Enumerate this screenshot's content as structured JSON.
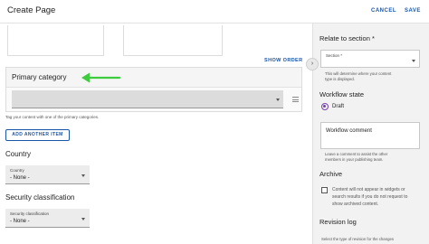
{
  "header": {
    "title": "Create Page",
    "cancel_label": "CANCEL",
    "save_label": "SAVE"
  },
  "main": {
    "show_order_label": "SHOW ORDER",
    "primary_category": {
      "title": "Primary category",
      "selected_value": "",
      "help_text": "Tag your content with one of the primary categories."
    },
    "add_item_label": "ADD ANOTHER ITEM",
    "country": {
      "section_title": "Country",
      "field_label": "Country",
      "value": "- None -"
    },
    "security": {
      "section_title": "Security classification",
      "field_label": "Security classification",
      "value": "- None -"
    }
  },
  "sidebar": {
    "toggle_icon": "chevron-right-icon",
    "relate": {
      "title": "Relate to section *",
      "field_label": "Section *",
      "help_text_1": "This will determine where your content",
      "help_text_2": "type is displayed."
    },
    "workflow": {
      "title": "Workflow state",
      "option_label": "Draft",
      "accent_color": "#7a3fb5"
    },
    "workflow_comment": {
      "field_label": "Workflow comment",
      "help_text_1": "Leave a comment to assist the other",
      "help_text_2": "members in your publishing team."
    },
    "archive": {
      "title": "Archive",
      "checkbox_text_1": "Content will not appear in widgets or",
      "checkbox_text_2": "search results if you do not request to",
      "checkbox_text_3": "show archived content."
    },
    "revision": {
      "title": "Revision log",
      "help_text": "Select the type of revision for the changes"
    }
  },
  "colors": {
    "link_blue": "#1a56a8",
    "arrow_green": "#3dcc3d"
  }
}
